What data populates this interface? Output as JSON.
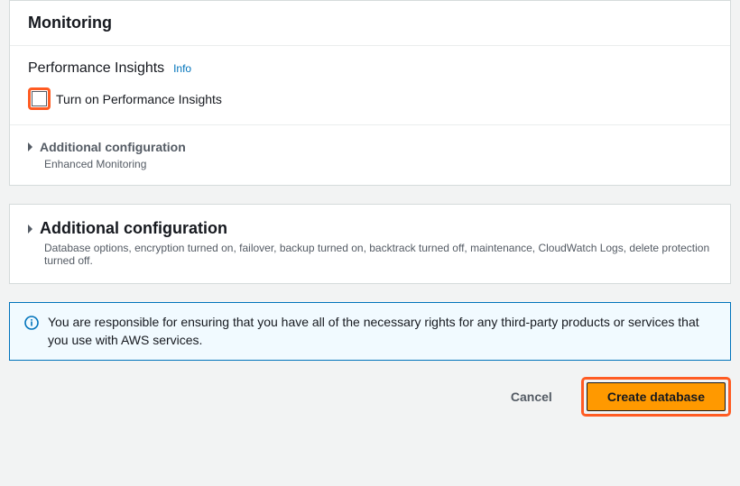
{
  "colors": {
    "accent": "#ff9900",
    "highlight": "#ff5b22",
    "link": "#0073bb"
  },
  "panel1": {
    "title": "Monitoring",
    "perf_title": "Performance Insights",
    "info_link": "Info",
    "checkbox_label": "Turn on Performance Insights",
    "expander_label": "Additional configuration",
    "expander_sub": "Enhanced Monitoring"
  },
  "panel2": {
    "expander_label": "Additional configuration",
    "summary": "Database options, encryption turned on, failover, backup turned on, backtrack turned off, maintenance, CloudWatch Logs, delete protection turned off."
  },
  "notice": {
    "text": "You are responsible for ensuring that you have all of the necessary rights for any third-party products or services that you use with AWS services."
  },
  "actions": {
    "cancel": "Cancel",
    "create": "Create database"
  },
  "icons": {
    "info": "info-icon",
    "caret": "chevron-right-icon"
  }
}
